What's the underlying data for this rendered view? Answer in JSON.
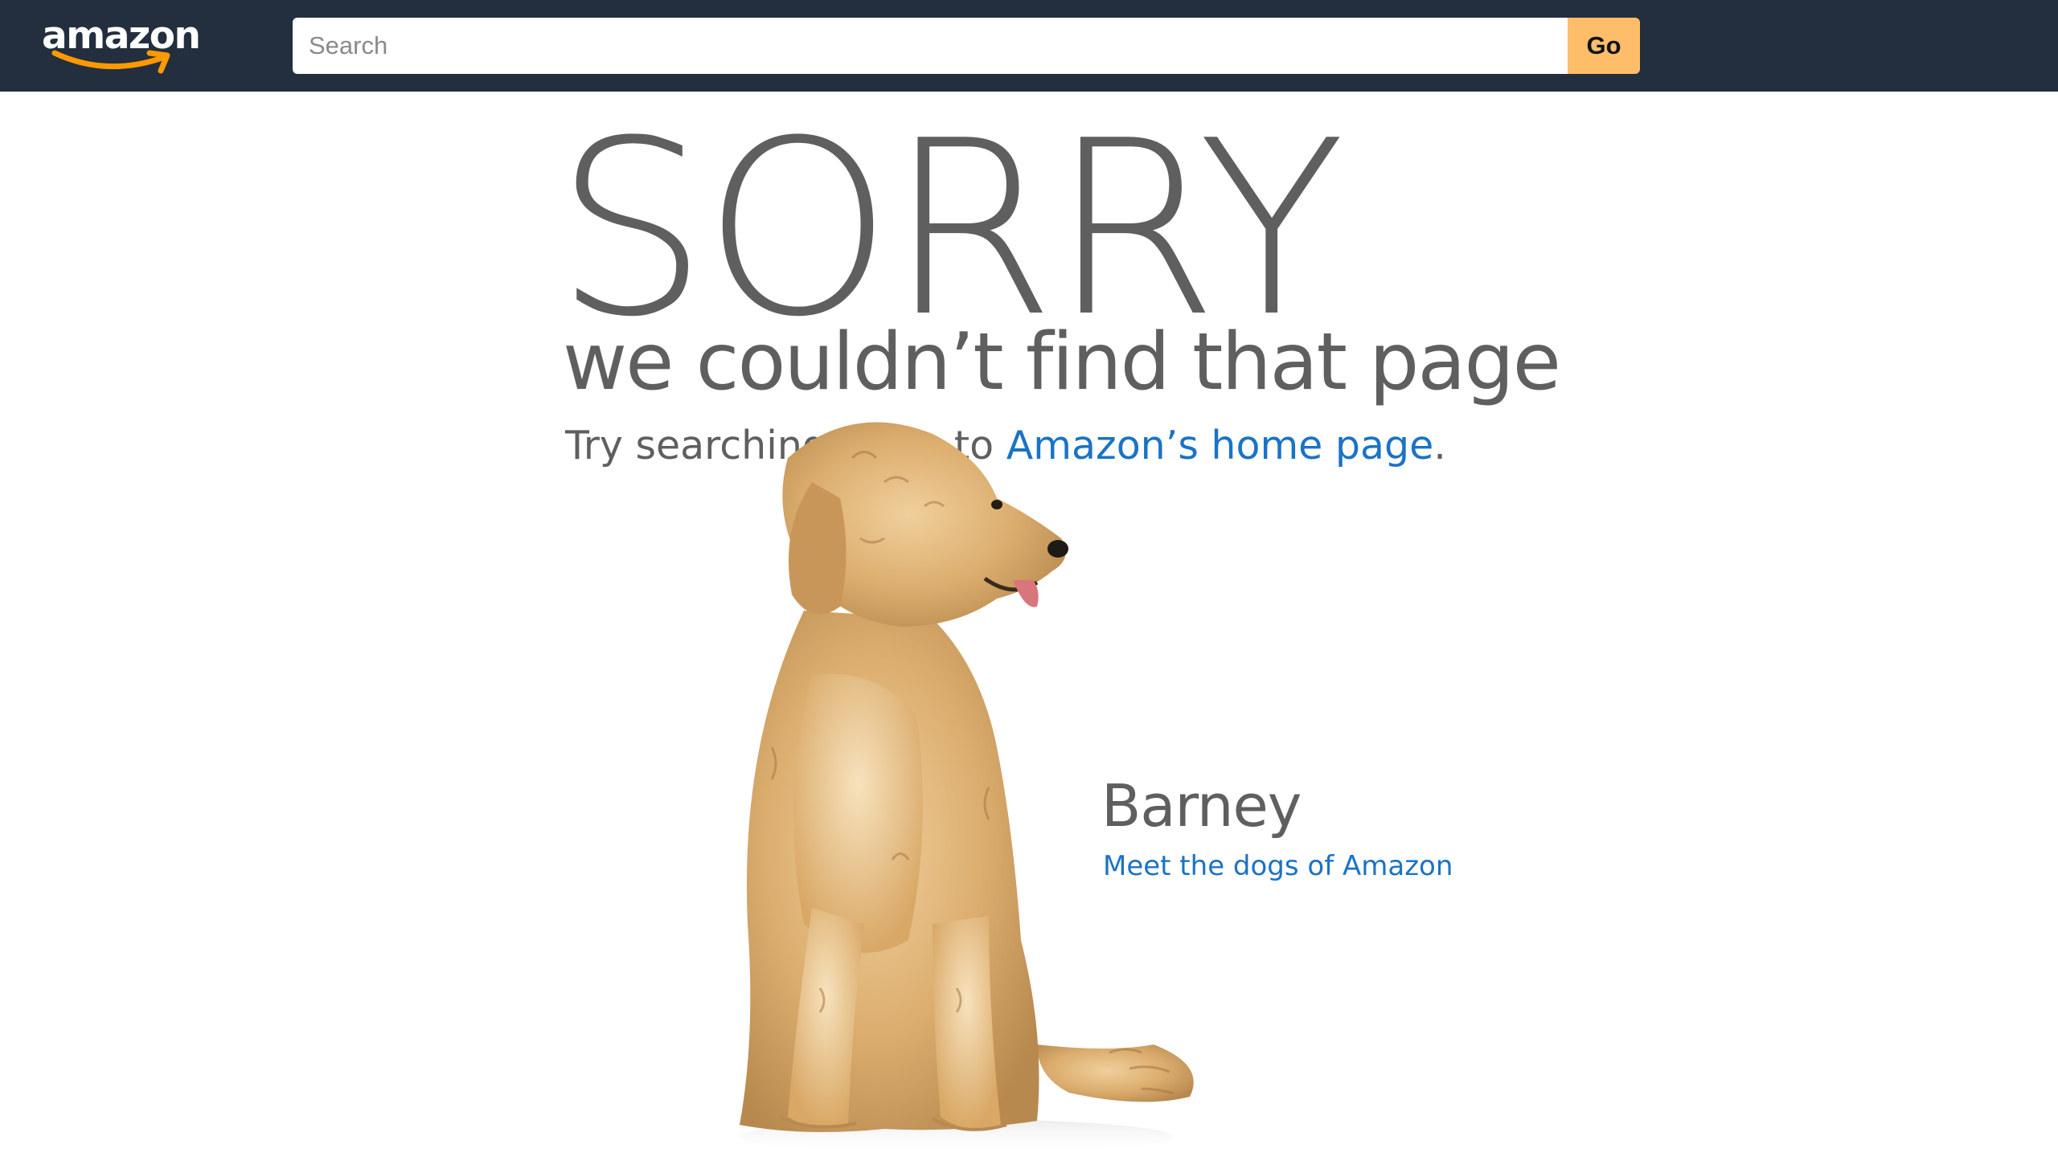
{
  "header": {
    "logo_text": "amazon",
    "search": {
      "placeholder": "Search",
      "value": ""
    },
    "go_label": "Go"
  },
  "main": {
    "headline": "SORRY",
    "subtitle": "we couldn’t find that page",
    "hint_prefix": "Try searching or go to ",
    "hint_link": "Amazon’s home page",
    "hint_suffix": "."
  },
  "dog": {
    "name": "Barney",
    "link_label": "Meet the dogs of Amazon"
  },
  "colors": {
    "header_bg": "#232f3e",
    "go_button": "#febd69",
    "link": "#1a73c6",
    "text_gray": "#5f5f5f",
    "logo_smile": "#ff9900"
  },
  "icons": {
    "logo": "amazon-logo",
    "smile": "amazon-smile-arrow-icon"
  }
}
